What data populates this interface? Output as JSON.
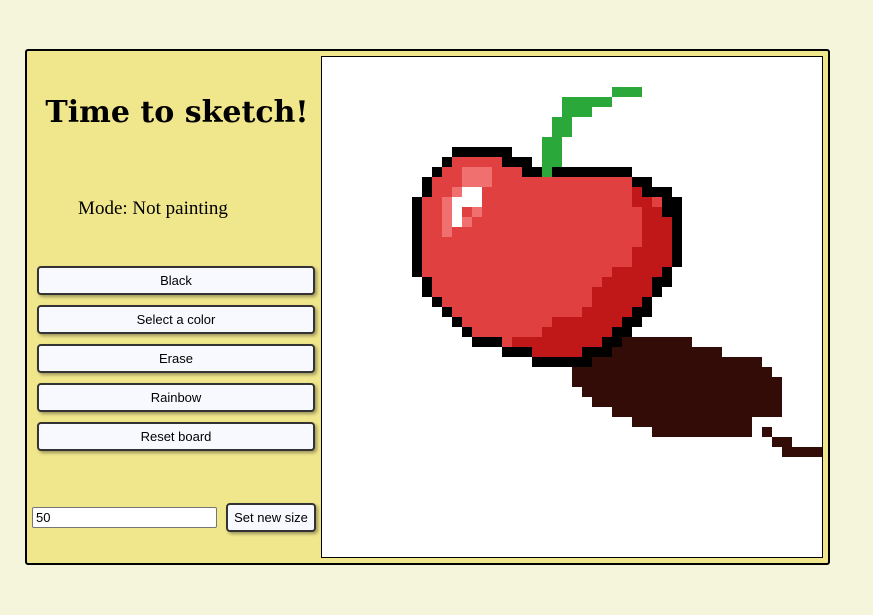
{
  "title": "Time to sketch!",
  "mode_text": "Mode: Not painting",
  "buttons": {
    "black": "Black",
    "select_color": "Select a color",
    "erase": "Erase",
    "rainbow": "Rainbow",
    "reset": "Reset board"
  },
  "grid_size": {
    "value": "50",
    "button": "Set new size"
  },
  "colors": {
    "page_background": "#f5f5dc",
    "panel_background": "#f0e68c",
    "button_background": "#f8f8ff",
    "board_background": "#ffffff",
    "apple_red": "#e04040",
    "apple_dark_red": "#c01818",
    "apple_highlight": "#f07070",
    "highlight_white": "#ffffff",
    "outline": "#000000",
    "stem_green": "#2aa83a",
    "shadow_brown": "#330c08"
  }
}
